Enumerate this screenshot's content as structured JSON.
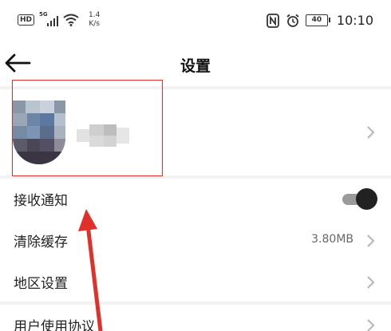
{
  "status_bar": {
    "hd": "HD",
    "network": "5G",
    "speed_value": "1.4",
    "speed_unit": "K/s",
    "battery": "40",
    "time": "10:10",
    "icons": [
      "hd-icon",
      "signal-icon",
      "wifi-icon",
      "nfc-icon",
      "alarm-icon",
      "battery-icon"
    ]
  },
  "header": {
    "title": "设置",
    "back_icon": "back-arrow-icon"
  },
  "profile": {
    "chevron_icon": "chevron-right-icon"
  },
  "settings": {
    "receive_notifications": {
      "label": "接收通知",
      "toggle_on": true
    },
    "clear_cache": {
      "label": "清除缓存",
      "value": "3.80MB"
    },
    "region": {
      "label": "地区设置"
    },
    "user_agreement": {
      "label": "用户使用协议"
    }
  },
  "annotation": {
    "highlight_color": "#e0302a"
  }
}
